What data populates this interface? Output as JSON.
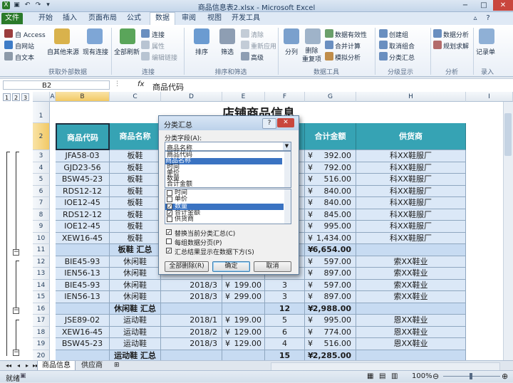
{
  "window": {
    "title": "商品信息表2.xlsx - Microsoft Excel",
    "controls": [
      "−",
      "□",
      "✕"
    ]
  },
  "ribbon_tabs": [
    "文件",
    "开始",
    "插入",
    "页面布局",
    "公式",
    "数据",
    "审阅",
    "视图",
    "开发工具"
  ],
  "ribbon": {
    "get_external": {
      "items": [
        "自 Access",
        "自网站",
        "自文本"
      ],
      "other": "自其他来源",
      "existing": "现有连接",
      "label": "获取外部数据"
    },
    "connections": {
      "refresh": "全部刷新",
      "items": [
        "连接",
        "属性",
        "编辑链接"
      ],
      "label": "连接"
    },
    "sort_filter": {
      "sort": "排序",
      "filter": "筛选",
      "items": [
        "清除",
        "重新应用",
        "高级"
      ],
      "label": "排序和筛选"
    },
    "data_tools": {
      "split": "分列",
      "remove": "删除\n重复项",
      "items": [
        "数据有效性",
        "合并计算",
        "模拟分析"
      ],
      "label": "数据工具"
    },
    "outline": {
      "items": [
        "创建组",
        "取消组合",
        "分类汇总"
      ],
      "label": "分级显示"
    },
    "analysis": {
      "items": [
        "数据分析",
        "规划求解"
      ],
      "label": "分析"
    },
    "entry": {
      "items": [
        "记录单"
      ],
      "label": "录入"
    }
  },
  "formula_bar": {
    "name_box": "B2",
    "fx": "fx",
    "content": "商品代码"
  },
  "columns": [
    "A",
    "B",
    "C",
    "D",
    "E",
    "F",
    "G",
    "H",
    "I"
  ],
  "outline_levels": [
    "1",
    "2",
    "3"
  ],
  "sheet": {
    "title": "店铺商品信息",
    "headers": [
      "商品代码",
      "商品名称",
      "",
      "",
      "",
      "合计金额",
      "供货商"
    ],
    "rows": [
      {
        "num": "3",
        "code": "JFA58-03",
        "name": "板鞋",
        "total_sym": "¥",
        "total": "392.00",
        "supplier": "科XX鞋服厂"
      },
      {
        "num": "4",
        "code": "GJD23-56",
        "name": "板鞋",
        "total_sym": "¥",
        "total": "792.00",
        "supplier": "科XX鞋服厂"
      },
      {
        "num": "5",
        "code": "BSW45-23",
        "name": "板鞋",
        "total_sym": "¥",
        "total": "516.00",
        "supplier": "科XX鞋服厂"
      },
      {
        "num": "6",
        "code": "RDS12-12",
        "name": "板鞋",
        "total_sym": "¥",
        "total": "840.00",
        "supplier": "科XX鞋服厂"
      },
      {
        "num": "7",
        "code": "IOE12-45",
        "name": "板鞋",
        "total_sym": "¥",
        "total": "840.00",
        "supplier": "科XX鞋服厂"
      },
      {
        "num": "8",
        "code": "RDS12-12",
        "name": "板鞋",
        "total_sym": "¥",
        "total": "845.00",
        "supplier": "科XX鞋服厂"
      },
      {
        "num": "9",
        "code": "IOE12-45",
        "name": "板鞋",
        "total_sym": "¥",
        "total": "995.00",
        "supplier": "科XX鞋服厂"
      },
      {
        "num": "10",
        "code": "XEW16-45",
        "name": "板鞋",
        "total_sym": "¥",
        "total": "1,434.00",
        "supplier": "科XX鞋服厂"
      },
      {
        "num": "11",
        "summary": "板鞋 汇总",
        "total_sym": "¥",
        "total": "6,654.00"
      },
      {
        "num": "12",
        "code": "BIE45-93",
        "name": "休闲鞋",
        "total_sym": "¥",
        "total": "597.00",
        "supplier": "索XX鞋业"
      },
      {
        "num": "13",
        "code": "IEN56-13",
        "name": "休闲鞋",
        "total_sym": "¥",
        "total": "897.00",
        "supplier": "索XX鞋业"
      },
      {
        "num": "14",
        "code": "BIE45-93",
        "name": "休闲鞋",
        "date": "2018/3",
        "price_sym": "¥",
        "price": "199.00",
        "qty": "3",
        "total_sym": "¥",
        "total": "597.00",
        "supplier": "索XX鞋业"
      },
      {
        "num": "15",
        "code": "IEN56-13",
        "name": "休闲鞋",
        "date": "2018/3",
        "price_sym": "¥",
        "price": "299.00",
        "qty": "3",
        "total_sym": "¥",
        "total": "897.00",
        "supplier": "索XX鞋业"
      },
      {
        "num": "16",
        "summary": "休闲鞋 汇总",
        "qty": "12",
        "total_sym": "¥",
        "total": "2,988.00"
      },
      {
        "num": "17",
        "code": "JSE89-02",
        "name": "运动鞋",
        "date": "2018/1",
        "price_sym": "¥",
        "price": "199.00",
        "qty": "5",
        "total_sym": "¥",
        "total": "995.00",
        "supplier": "恩XX鞋业"
      },
      {
        "num": "18",
        "code": "XEW16-45",
        "name": "运动鞋",
        "date": "2018/2",
        "price_sym": "¥",
        "price": "129.00",
        "qty": "6",
        "total_sym": "¥",
        "total": "774.00",
        "supplier": "恩XX鞋业"
      },
      {
        "num": "19",
        "code": "BSW45-23",
        "name": "运动鞋",
        "date": "2018/3",
        "price_sym": "¥",
        "price": "129.00",
        "qty": "4",
        "total_sym": "¥",
        "total": "516.00",
        "supplier": "恩XX鞋业"
      },
      {
        "num": "20",
        "summary": "运动鞋 汇总",
        "qty": "15",
        "total_sym": "¥",
        "total": "2,285.00"
      }
    ]
  },
  "sheet_tabs": [
    "商品信息",
    "供应商"
  ],
  "status": {
    "ready": "就绪",
    "zoom": "100%"
  },
  "dialog": {
    "title": "分类汇总",
    "help": "?",
    "close": "✕",
    "group_label": "分类字段(A):",
    "group_value": "商品名称",
    "group_options": [
      "商品代码",
      "商品名称",
      "时间",
      "单价",
      "数量",
      "合计金额"
    ],
    "items": [
      {
        "label": "时间",
        "checked": false
      },
      {
        "label": "单价",
        "checked": false
      },
      {
        "label": "数量",
        "checked": true
      },
      {
        "label": "合计金额",
        "checked": true
      },
      {
        "label": "供货商",
        "checked": false
      }
    ],
    "options": [
      {
        "label": "替换当前分类汇总(C)",
        "checked": true
      },
      {
        "label": "每组数据分页(P)",
        "checked": false
      },
      {
        "label": "汇总结果显示在数据下方(S)",
        "checked": true
      }
    ],
    "buttons": [
      "全部删除(R)",
      "确定",
      "取消"
    ]
  }
}
